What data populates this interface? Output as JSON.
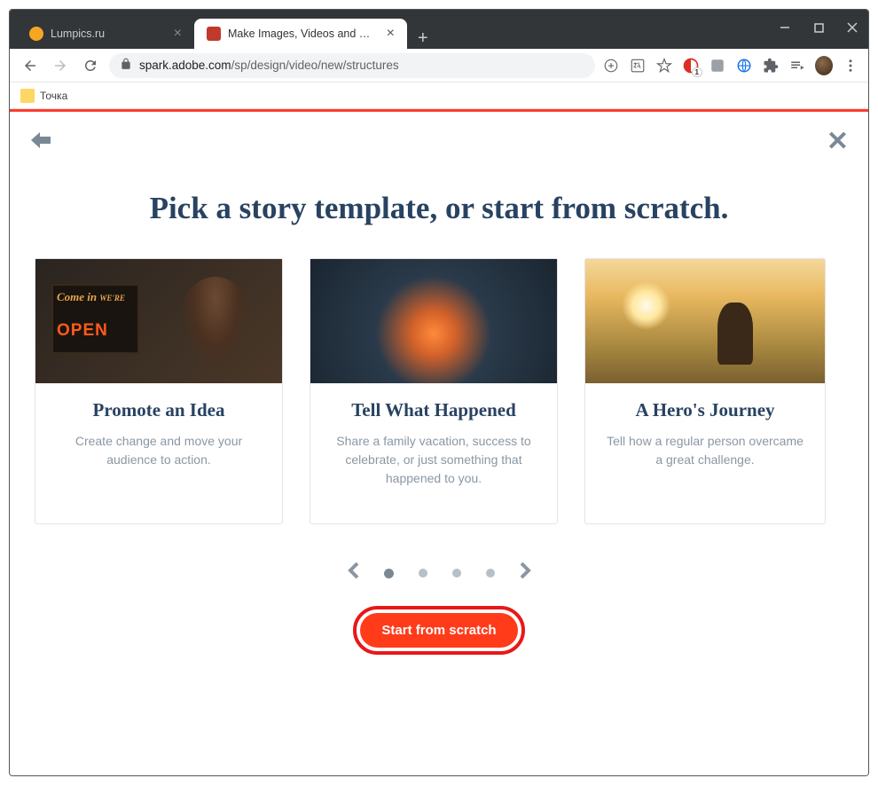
{
  "window": {
    "tabs": [
      {
        "title": "Lumpics.ru",
        "active": false,
        "favicon_color": "#f5a623"
      },
      {
        "title": "Make Images, Videos and Web S",
        "active": true,
        "favicon_color": "#c0392b"
      }
    ]
  },
  "address": {
    "host": "spark.adobe.com",
    "path": "/sp/design/video/new/structures"
  },
  "bookmarks": [
    {
      "label": "Точка"
    }
  ],
  "page": {
    "title": "Pick a story template, or start from scratch.",
    "cards": [
      {
        "title": "Promote an Idea",
        "desc": "Create change and move your audience to action.",
        "sign_line1": "Come in",
        "sign_line2": "WE'RE",
        "sign_open": "OPEN"
      },
      {
        "title": "Tell What Happened",
        "desc": "Share a family vacation, success to celebrate, or just something that happened to you."
      },
      {
        "title": "A Hero's Journey",
        "desc": "Tell how a regular person overcame a great challenge."
      }
    ],
    "pager": {
      "dots": 4,
      "active": 0
    },
    "cta": "Start from scratch"
  },
  "ext_badge": "1"
}
